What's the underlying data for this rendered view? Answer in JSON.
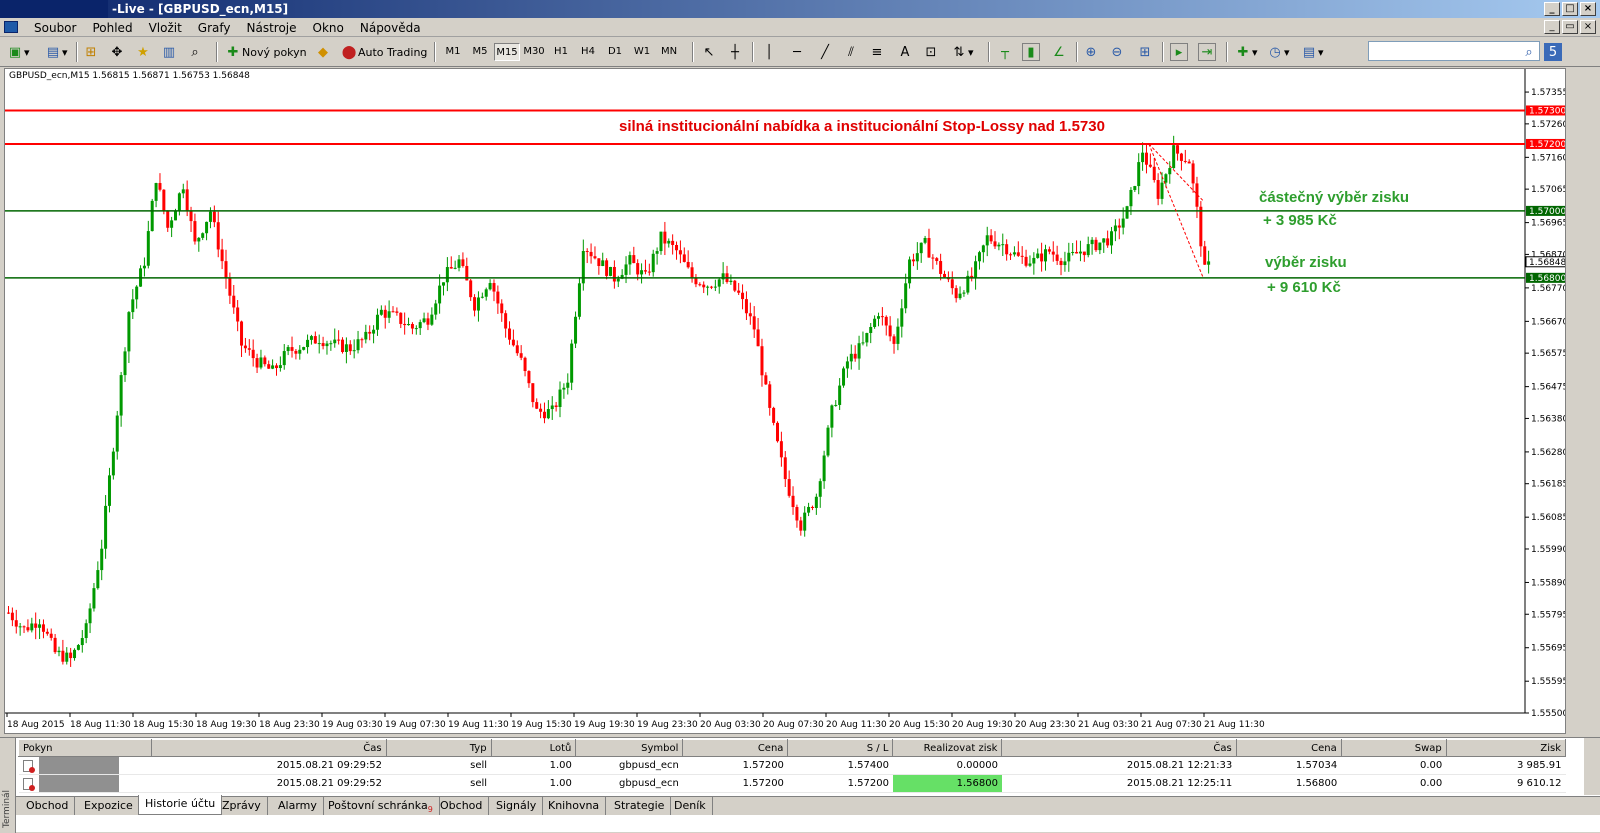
{
  "window": {
    "title": "-Live - [GBPUSD_ecn,M15]"
  },
  "menu": {
    "items": [
      "Soubor",
      "Pohled",
      "Vložit",
      "Grafy",
      "Nástroje",
      "Okno",
      "Nápověda"
    ]
  },
  "toolbar": {
    "new_order": "Nový pokyn",
    "auto_trading": "Auto Trading",
    "timeframes": [
      "M1",
      "M5",
      "M15",
      "M30",
      "H1",
      "H4",
      "D1",
      "W1",
      "MN"
    ],
    "active_timeframe": "M15"
  },
  "chart": {
    "header": "GBPUSD_ecn,M15  1.56815 1.56871 1.56753 1.56848",
    "annotations": {
      "red_note": "silná institucionální nabídka a institucionální Stop-Lossy nad 1.5730",
      "partial_take": "částečný výběr zisku",
      "partial_amount": "+ 3 985 Kč",
      "take_profit": "výběr zisku",
      "take_amount": "+ 9 610 Kč"
    },
    "colors": {
      "bull": "#009900",
      "bear": "#ff0000",
      "red_line": "#ff0000",
      "green_line": "#006600",
      "green_text": "#2e9e2e",
      "red_text": "#e00000"
    }
  },
  "chart_data": {
    "type": "candlestick",
    "symbol": "GBPUSD_ecn",
    "timeframe": "M15",
    "ylim": [
      1.555,
      1.574
    ],
    "price_ticks": [
      "1.57355",
      "1.57260",
      "1.57160",
      "1.57065",
      "1.56965",
      "1.56870",
      "1.56770",
      "1.56670",
      "1.56575",
      "1.56475",
      "1.56380",
      "1.56280",
      "1.56185",
      "1.56085",
      "1.55990",
      "1.55890",
      "1.55795",
      "1.55695",
      "1.55595",
      "1.55500"
    ],
    "time_ticks": [
      "18 Aug 2015",
      "18 Aug 11:30",
      "18 Aug 15:30",
      "18 Aug 19:30",
      "18 Aug 23:30",
      "19 Aug 03:30",
      "19 Aug 07:30",
      "19 Aug 11:30",
      "19 Aug 15:30",
      "19 Aug 19:30",
      "19 Aug 23:30",
      "20 Aug 03:30",
      "20 Aug 07:30",
      "20 Aug 11:30",
      "20 Aug 15:30",
      "20 Aug 19:30",
      "20 Aug 23:30",
      "21 Aug 03:30",
      "21 Aug 07:30",
      "21 Aug 11:30"
    ],
    "horizontal_lines": [
      {
        "price": 1.573,
        "label": "1.57300",
        "color": "#ff0000"
      },
      {
        "price": 1.572,
        "label": "1.57200",
        "color": "#ff0000"
      },
      {
        "price": 1.57,
        "label": "1.57000",
        "color": "#006600"
      },
      {
        "price": 1.568,
        "label": "1.56800",
        "color": "#006600"
      }
    ],
    "current_price": {
      "price": 1.56848,
      "label": "1.56848"
    },
    "path": [
      [
        0,
        1.558
      ],
      [
        4,
        1.5575
      ],
      [
        8,
        1.5578
      ],
      [
        12,
        1.5568
      ],
      [
        16,
        1.5566
      ],
      [
        20,
        1.5575
      ],
      [
        24,
        1.56
      ],
      [
        28,
        1.564
      ],
      [
        31,
        1.567
      ],
      [
        35,
        1.5685
      ],
      [
        38,
        1.571
      ],
      [
        41,
        1.5695
      ],
      [
        45,
        1.5708
      ],
      [
        48,
        1.569
      ],
      [
        52,
        1.57
      ],
      [
        56,
        1.568
      ],
      [
        60,
        1.566
      ],
      [
        64,
        1.5655
      ],
      [
        68,
        1.5652
      ],
      [
        72,
        1.5658
      ],
      [
        76,
        1.566
      ],
      [
        80,
        1.5662
      ],
      [
        84,
        1.566
      ],
      [
        88,
        1.5659
      ],
      [
        92,
        1.5662
      ],
      [
        96,
        1.567
      ],
      [
        100,
        1.5668
      ],
      [
        104,
        1.5665
      ],
      [
        108,
        1.5668
      ],
      [
        112,
        1.568
      ],
      [
        116,
        1.5685
      ],
      [
        120,
        1.5672
      ],
      [
        124,
        1.568
      ],
      [
        128,
        1.5665
      ],
      [
        132,
        1.5655
      ],
      [
        136,
        1.564
      ],
      [
        140,
        1.564
      ],
      [
        144,
        1.565
      ],
      [
        148,
        1.569
      ],
      [
        152,
        1.5685
      ],
      [
        156,
        1.568
      ],
      [
        160,
        1.5685
      ],
      [
        164,
        1.568
      ],
      [
        168,
        1.5692
      ],
      [
        172,
        1.5688
      ],
      [
        176,
        1.568
      ],
      [
        180,
        1.5678
      ],
      [
        184,
        1.568
      ],
      [
        188,
        1.5675
      ],
      [
        192,
        1.5665
      ],
      [
        196,
        1.564
      ],
      [
        200,
        1.562
      ],
      [
        204,
        1.5606
      ],
      [
        208,
        1.5615
      ],
      [
        212,
        1.564
      ],
      [
        216,
        1.5655
      ],
      [
        220,
        1.566
      ],
      [
        224,
        1.567
      ],
      [
        228,
        1.566
      ],
      [
        232,
        1.5685
      ],
      [
        236,
        1.569
      ],
      [
        240,
        1.5682
      ],
      [
        244,
        1.5675
      ],
      [
        248,
        1.568
      ],
      [
        252,
        1.5692
      ],
      [
        256,
        1.569
      ],
      [
        260,
        1.5686
      ],
      [
        264,
        1.5685
      ],
      [
        268,
        1.5688
      ],
      [
        272,
        1.5685
      ],
      [
        276,
        1.5688
      ],
      [
        280,
        1.569
      ],
      [
        284,
        1.5692
      ],
      [
        288,
        1.57
      ],
      [
        292,
        1.5718
      ],
      [
        296,
        1.5705
      ],
      [
        300,
        1.5718
      ],
      [
        304,
        1.5715
      ],
      [
        306,
        1.57
      ],
      [
        308,
        1.5682
      ],
      [
        310,
        1.5685
      ]
    ]
  },
  "terminal": {
    "side_label": "Terminál",
    "columns": [
      "Pokyn",
      "Čas",
      "Typ",
      "Lotů",
      "Symbol",
      "Cena",
      "S / L",
      "Realizovat zisk",
      "Čas",
      "Cena",
      "Swap",
      "Zisk"
    ],
    "rows": [
      {
        "time": "2015.08.21 09:29:52",
        "type": "sell",
        "lots": "1.00",
        "symbol": "gbpusd_ecn",
        "price": "1.57200",
        "sl": "1.57400",
        "tp": "0.00000",
        "close_time": "2015.08.21 12:21:33",
        "close_price": "1.57034",
        "swap": "0.00",
        "profit": "3 985.91"
      },
      {
        "time": "2015.08.21 09:29:52",
        "type": "sell",
        "lots": "1.00",
        "symbol": "gbpusd_ecn",
        "price": "1.57200",
        "sl": "1.57200",
        "tp": "1.56800",
        "close_time": "2015.08.21 12:25:11",
        "close_price": "1.56800",
        "swap": "0.00",
        "profit": "9 610.12"
      }
    ],
    "tabs": [
      "Obchod",
      "Expozice",
      "Historie účtu",
      "Zprávy",
      "Alarmy",
      "Poštovní schránka",
      "Obchod",
      "Signály",
      "Knihovna",
      "Strategie",
      "Deník"
    ],
    "active_tab": "Historie účtu",
    "mail_badge": "9"
  }
}
